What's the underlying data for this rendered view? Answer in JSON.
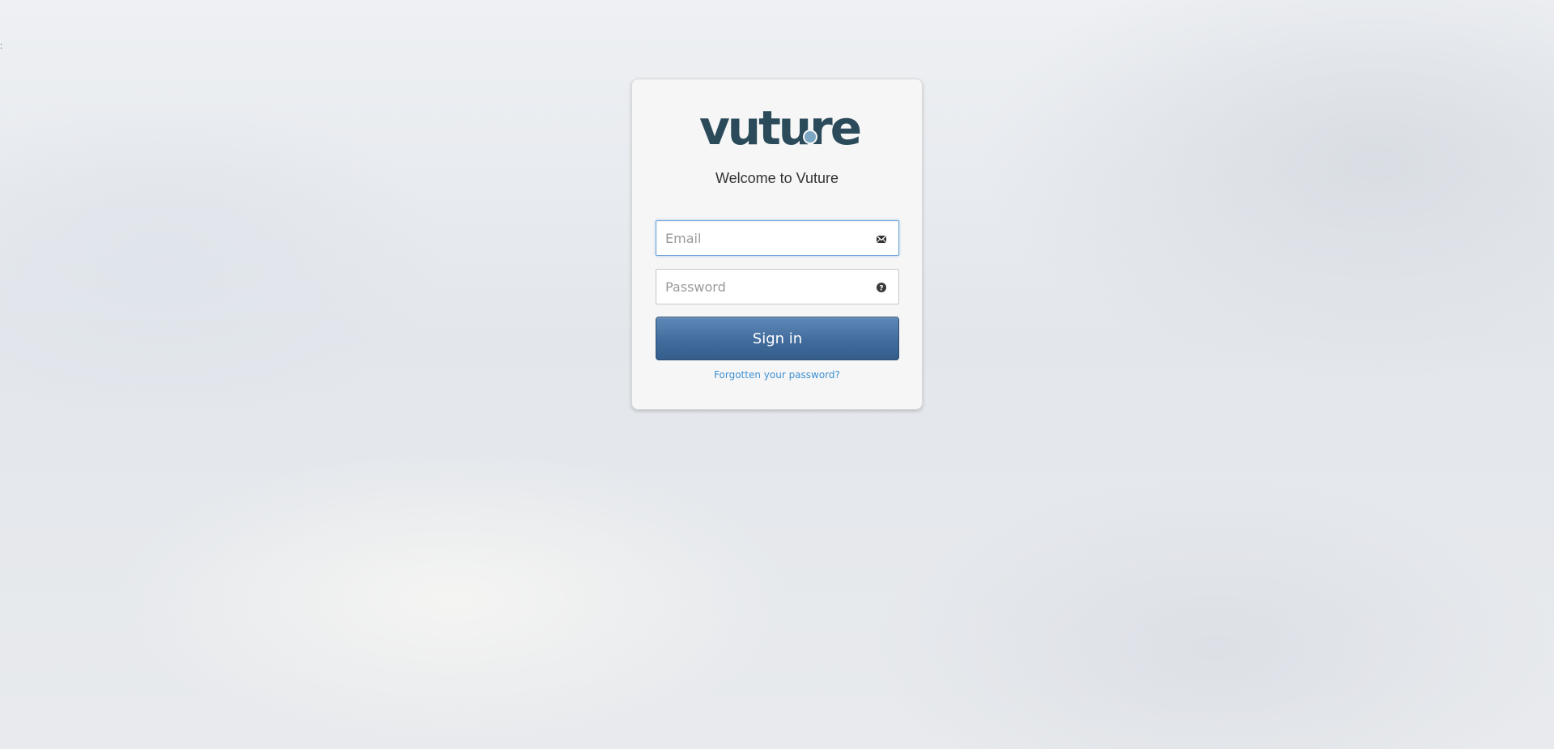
{
  "page": {
    "edge_mark": ":"
  },
  "brand": {
    "logo_text": "vuture",
    "colors": {
      "logo": "#2b4a5a",
      "logo_dot": "#7ba6c4",
      "button": "#416c9d",
      "link": "#3d8fd1",
      "focus_border": "#72a7d8"
    }
  },
  "login": {
    "welcome": "Welcome to Vuture",
    "email": {
      "value": "",
      "placeholder": "Email",
      "icon": "envelope-icon"
    },
    "password": {
      "value": "",
      "placeholder": "Password",
      "icon": "question-circle-icon"
    },
    "submit_label": "Sign in",
    "forgot_label": "Forgotten your password?"
  }
}
